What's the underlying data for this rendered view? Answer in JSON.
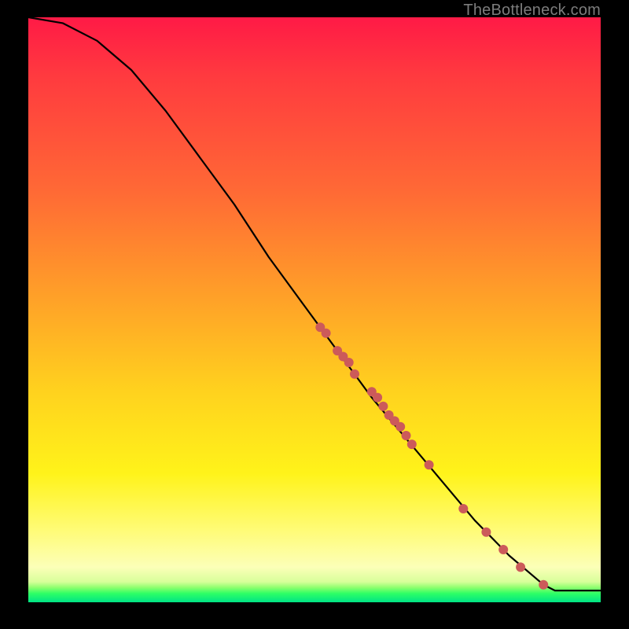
{
  "watermark": "TheBottleneck.com",
  "colors": {
    "curve": "#000000",
    "marker": "#cc5a5a",
    "background_top": "#ff1a46",
    "background_bottom": "#00e386"
  },
  "chart_data": {
    "type": "line",
    "title": "",
    "xlabel": "",
    "ylabel": "",
    "xlim": [
      0,
      100
    ],
    "ylim": [
      0,
      100
    ],
    "grid": false,
    "legend": false,
    "curve_comment": "Decreasing S-curve; y estimated as fraction of plot height from bottom (100=top).",
    "curve": [
      {
        "x": 0,
        "y": 100
      },
      {
        "x": 6,
        "y": 99
      },
      {
        "x": 12,
        "y": 96
      },
      {
        "x": 18,
        "y": 91
      },
      {
        "x": 24,
        "y": 84
      },
      {
        "x": 30,
        "y": 76
      },
      {
        "x": 36,
        "y": 68
      },
      {
        "x": 42,
        "y": 59
      },
      {
        "x": 48,
        "y": 51
      },
      {
        "x": 54,
        "y": 43
      },
      {
        "x": 60,
        "y": 35
      },
      {
        "x": 66,
        "y": 28
      },
      {
        "x": 72,
        "y": 21
      },
      {
        "x": 78,
        "y": 14
      },
      {
        "x": 84,
        "y": 8
      },
      {
        "x": 90,
        "y": 3
      },
      {
        "x": 92,
        "y": 2
      },
      {
        "x": 100,
        "y": 2
      }
    ],
    "markers_comment": "Red sample points along the curve, roughly mid-to-lower section.",
    "markers": [
      {
        "x": 51,
        "y": 47
      },
      {
        "x": 52,
        "y": 46
      },
      {
        "x": 54,
        "y": 43
      },
      {
        "x": 55,
        "y": 42
      },
      {
        "x": 56,
        "y": 41
      },
      {
        "x": 57,
        "y": 39
      },
      {
        "x": 60,
        "y": 36
      },
      {
        "x": 61,
        "y": 35
      },
      {
        "x": 62,
        "y": 33.5
      },
      {
        "x": 63,
        "y": 32
      },
      {
        "x": 64,
        "y": 31
      },
      {
        "x": 65,
        "y": 30
      },
      {
        "x": 66,
        "y": 28.5
      },
      {
        "x": 67,
        "y": 27
      },
      {
        "x": 70,
        "y": 23.5
      },
      {
        "x": 76,
        "y": 16
      },
      {
        "x": 80,
        "y": 12
      },
      {
        "x": 83,
        "y": 9
      },
      {
        "x": 86,
        "y": 6
      },
      {
        "x": 90,
        "y": 3
      }
    ],
    "marker_radius_px": 6
  }
}
